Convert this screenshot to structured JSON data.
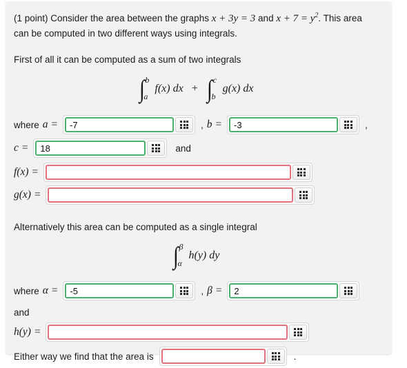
{
  "problem": {
    "points_label": "(1 point)",
    "intro_prefix": "Consider the area between the graphs",
    "graph_eq_1": "x + 3y = 3",
    "graph_eq_1_lhs": "x + 3y = 3",
    "intro_and": "and",
    "graph_eq_2_base": "x + 7 = y",
    "graph_eq_2_exp": "2",
    "intro_suffix": ". This area can be computed in two different ways using integrals.",
    "line2": "First of all it can be computed as a sum of two integrals",
    "alt_line": "Alternatively this area can be computed as a single integral",
    "final_line": "Either way we find that the area is"
  },
  "integral_sum": {
    "first": {
      "lower": "a",
      "upper": "b",
      "integrand": "f(x) dx"
    },
    "operator": "+",
    "second": {
      "lower": "b",
      "upper": "c",
      "integrand": "g(x) dx"
    }
  },
  "integral_single": {
    "lower": "α",
    "upper": "β",
    "integrand": "h(y) dy"
  },
  "fields": {
    "where_label": "where",
    "and_label": "and",
    "comma": ",",
    "period": ".",
    "a": {
      "label": "a",
      "equals": "=",
      "value": "-7",
      "status": "correct"
    },
    "b": {
      "label": "b",
      "equals": "=",
      "value": "-3",
      "status": "correct"
    },
    "c": {
      "label": "c",
      "equals": "=",
      "value": "18",
      "status": "correct"
    },
    "fx": {
      "label": "f(x)",
      "equals": "=",
      "value": "",
      "status": "incorrect",
      "focused": true
    },
    "gx": {
      "label": "g(x)",
      "equals": "=",
      "value": "",
      "status": "incorrect"
    },
    "alpha": {
      "label": "α",
      "equals": "=",
      "value": "-5",
      "status": "correct"
    },
    "beta": {
      "label": "β",
      "equals": "=",
      "value": "2",
      "status": "correct"
    },
    "hy": {
      "label": "h(y)",
      "equals": "=",
      "value": "",
      "status": "incorrect"
    },
    "area": {
      "value": "",
      "status": "incorrect"
    }
  },
  "colors": {
    "correct_border": "#4caf6d",
    "incorrect_border": "#e2707e",
    "panel_bg": "#f2f2f2",
    "text": "#1a1a1a"
  },
  "icons": {
    "keypad": "keypad-icon"
  }
}
